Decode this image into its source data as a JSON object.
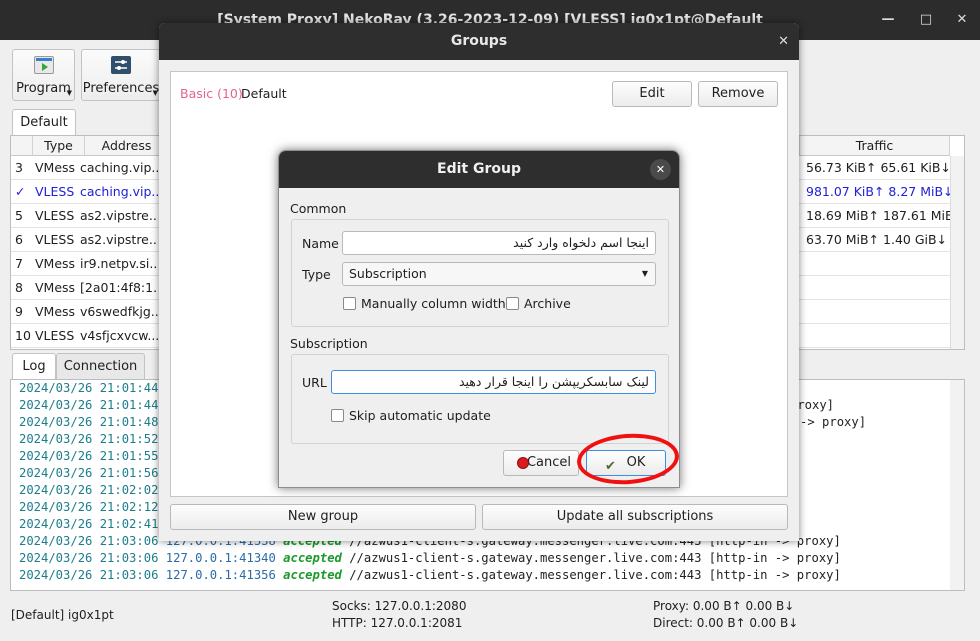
{
  "main": {
    "title": "[System Proxy] NekoRay (3.26-2023-12-09) [VLESS] ig0x1pt@Default",
    "toolbar": {
      "program_label": "Program",
      "preferences_label": "Preferences"
    },
    "group_tab": "Default",
    "columns": [
      "Type",
      "Address",
      "Traffic"
    ],
    "rows": [
      {
        "num": "3",
        "type": "VMess",
        "address": "caching.vip...",
        "traffic": "56.73 KiB↑ 65.61 KiB↓"
      },
      {
        "num": "✓",
        "type": "VLESS",
        "address": "caching.vip...",
        "traffic": "981.07 KiB↑ 8.27 MiB↓",
        "selected": true
      },
      {
        "num": "5",
        "type": "VLESS",
        "address": "as2.vipstre...",
        "traffic": "18.69 MiB↑ 187.61 MiB↓"
      },
      {
        "num": "6",
        "type": "VLESS",
        "address": "as2.vipstre...",
        "traffic": "63.70 MiB↑ 1.40 GiB↓"
      },
      {
        "num": "7",
        "type": "VMess",
        "address": "ir9.netpv.si...",
        "traffic": ""
      },
      {
        "num": "8",
        "type": "VMess",
        "address": "[2a01:4f8:1...",
        "traffic": ""
      },
      {
        "num": "9",
        "type": "VMess",
        "address": "v6swedfkjg...",
        "traffic": ""
      },
      {
        "num": "10",
        "type": "VLESS",
        "address": "v4sfjcxvcw...",
        "traffic": ""
      }
    ],
    "bottom_tabs": [
      "Log",
      "Connection"
    ],
    "log": [
      {
        "ts": "2024/03/26 21:01:44",
        "addr": "",
        "acc": "",
        "rest": ""
      },
      {
        "ts": "2024/03/26 21:01:44",
        "addr": "",
        "acc": "",
        "rest": "proxy]"
      },
      {
        "ts": "2024/03/26 21:01:48",
        "addr": "",
        "acc": "",
        "rest": "[http-in -> proxy]"
      },
      {
        "ts": "2024/03/26 21:01:52",
        "addr": "",
        "acc": "",
        "rest": ""
      },
      {
        "ts": "2024/03/26 21:01:55",
        "addr": "",
        "acc": "",
        "rest": ""
      },
      {
        "ts": "2024/03/26 21:01:56",
        "addr": "",
        "acc": "",
        "rest": ""
      },
      {
        "ts": "2024/03/26 21:02:02",
        "addr": "",
        "acc": "",
        "rest": ""
      },
      {
        "ts": "2024/03/26 21:02:12",
        "addr": "",
        "acc": "",
        "rest": ""
      },
      {
        "ts": "2024/03/26 21:02:41",
        "addr": "",
        "acc": "",
        "rest": ""
      },
      {
        "ts": "2024/03/26 21:03:06",
        "addr": "127.0.0.1:41338",
        "acc": "accepted",
        "rest": "//azwus1-client-s.gateway.messenger.live.com:443 [http-in -> proxy]"
      },
      {
        "ts": "2024/03/26 21:03:06",
        "addr": "127.0.0.1:41340",
        "acc": "accepted",
        "rest": "//azwus1-client-s.gateway.messenger.live.com:443 [http-in -> proxy]"
      },
      {
        "ts": "2024/03/26 21:03:06",
        "addr": "127.0.0.1:41356",
        "acc": "accepted",
        "rest": "//azwus1-client-s.gateway.messenger.live.com:443 [http-in -> proxy]"
      }
    ],
    "status": {
      "profile": "[Default] ig0x1pt",
      "socks": "Socks: 127.0.0.1:2080",
      "http": "HTTP: 127.0.0.1:2081",
      "proxy": "Proxy: 0.00 B↑ 0.00 B↓",
      "direct": "Direct: 0.00 B↑ 0.00 B↓"
    }
  },
  "groups_dialog": {
    "title": "Groups",
    "group_type": "Basic (10)",
    "group_name": "Default",
    "edit_label": "Edit",
    "remove_label": "Remove",
    "new_group_label": "New group",
    "update_all_label": "Update all subscriptions"
  },
  "edit_group": {
    "title": "Edit Group",
    "common_label": "Common",
    "name_label": "Name",
    "name_value": "اینجا اسم دلخواه وارد کنید",
    "type_label": "Type",
    "type_value": "Subscription",
    "manual_col_label": "Manually column width",
    "archive_label": "Archive",
    "subscription_label": "Subscription",
    "url_label": "URL",
    "url_value": "لینک سابسکریپشن را اینجا قرار دهید",
    "skip_update_label": "Skip automatic update",
    "cancel_label": "Cancel",
    "ok_label": "OK"
  },
  "colors": {
    "accent_red": "#f01010",
    "selected_row": "#2020d8",
    "group_type": "#e5648c",
    "accepted": "#1a9a28"
  }
}
